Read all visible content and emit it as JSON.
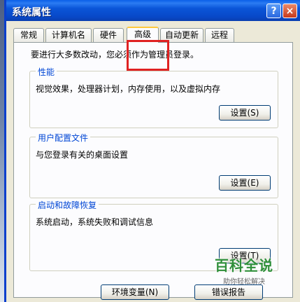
{
  "window": {
    "title": "系统属性",
    "help_glyph": "?",
    "close_glyph": "×"
  },
  "tabs": [
    {
      "label": "常规"
    },
    {
      "label": "计算机名"
    },
    {
      "label": "硬件"
    },
    {
      "label": "高级"
    },
    {
      "label": "自动更新"
    },
    {
      "label": "远程"
    }
  ],
  "active_tab": "高级",
  "notice": "要进行大多数改动，您必须作为管理员登录。",
  "groups": {
    "performance": {
      "label": "性能",
      "description": "视觉效果，处理器计划，内存使用，以及虚拟内存",
      "button": "设置(S)"
    },
    "user_profiles": {
      "label": "用户配置文件",
      "description": "与您登录有关的桌面设置",
      "button": "设置(E)"
    },
    "startup_recovery": {
      "label": "启动和故障恢复",
      "description": "系统启动，系统失败和调试信息",
      "button": "设置(T)"
    }
  },
  "buttons": {
    "env_vars": "环境变量(N)",
    "error_report": "错误报告"
  },
  "watermark": {
    "main": "百科全说",
    "sub": "助你轻松解决"
  },
  "colors": {
    "titlebar": "#0a55d8",
    "group_label": "#0046d5",
    "highlight": "#e02222",
    "active_tab_accent": "#ffc83c",
    "watermark": "#2f8f3a"
  }
}
